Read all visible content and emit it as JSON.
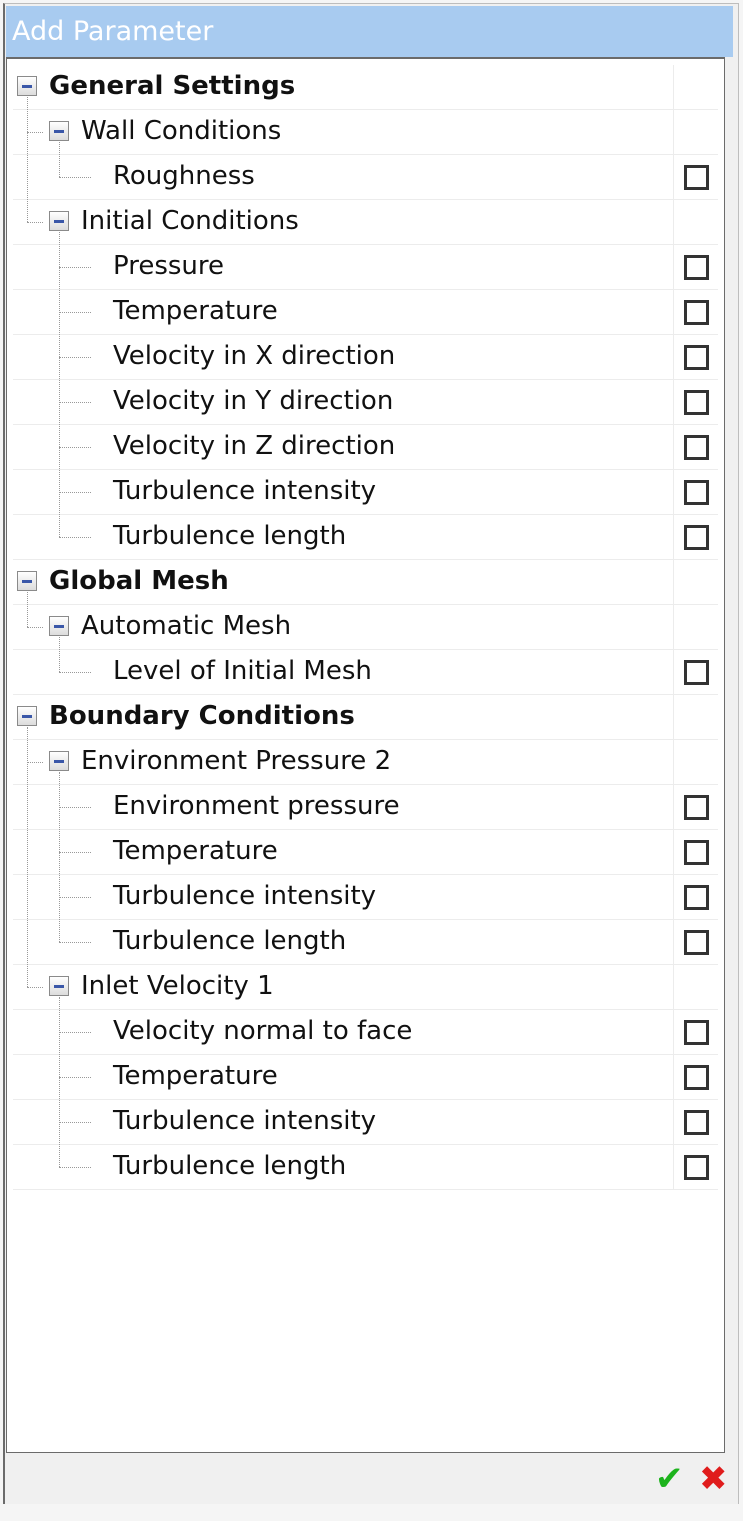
{
  "window": {
    "title": "Add Parameter"
  },
  "tree": [
    {
      "label": "General Settings",
      "level": 0,
      "expanded": true,
      "checkbox": false
    },
    {
      "label": "Wall Conditions",
      "level": 1,
      "expanded": true,
      "checkbox": false
    },
    {
      "label": "Roughness",
      "level": 2,
      "checkbox": true,
      "checked": false
    },
    {
      "label": "Initial Conditions",
      "level": 1,
      "expanded": true,
      "checkbox": false
    },
    {
      "label": "Pressure",
      "level": 2,
      "checkbox": true,
      "checked": false
    },
    {
      "label": "Temperature",
      "level": 2,
      "checkbox": true,
      "checked": false
    },
    {
      "label": "Velocity in X direction",
      "level": 2,
      "checkbox": true,
      "checked": false
    },
    {
      "label": "Velocity in Y direction",
      "level": 2,
      "checkbox": true,
      "checked": false
    },
    {
      "label": "Velocity in Z direction",
      "level": 2,
      "checkbox": true,
      "checked": false
    },
    {
      "label": "Turbulence intensity",
      "level": 2,
      "checkbox": true,
      "checked": false
    },
    {
      "label": "Turbulence length",
      "level": 2,
      "checkbox": true,
      "checked": false
    },
    {
      "label": "Global Mesh",
      "level": 0,
      "expanded": true,
      "checkbox": false
    },
    {
      "label": "Automatic Mesh",
      "level": 1,
      "expanded": true,
      "checkbox": false
    },
    {
      "label": "Level of Initial Mesh",
      "level": 2,
      "checkbox": true,
      "checked": false
    },
    {
      "label": "Boundary Conditions",
      "level": 0,
      "expanded": true,
      "checkbox": false
    },
    {
      "label": "Environment Pressure 2",
      "level": 1,
      "expanded": true,
      "checkbox": false
    },
    {
      "label": "Environment pressure",
      "level": 2,
      "checkbox": true,
      "checked": false
    },
    {
      "label": "Temperature",
      "level": 2,
      "checkbox": true,
      "checked": false
    },
    {
      "label": "Turbulence intensity",
      "level": 2,
      "checkbox": true,
      "checked": false
    },
    {
      "label": "Turbulence length",
      "level": 2,
      "checkbox": true,
      "checked": false
    },
    {
      "label": "Inlet Velocity 1",
      "level": 1,
      "expanded": true,
      "checkbox": false
    },
    {
      "label": "Velocity normal to face",
      "level": 2,
      "checkbox": true,
      "checked": false
    },
    {
      "label": "Temperature",
      "level": 2,
      "checkbox": true,
      "checked": false
    },
    {
      "label": "Turbulence intensity",
      "level": 2,
      "checkbox": true,
      "checked": false
    },
    {
      "label": "Turbulence length",
      "level": 2,
      "checkbox": true,
      "checked": false
    }
  ],
  "footer": {
    "ok_icon": "✔",
    "cancel_icon": "✖"
  },
  "colors": {
    "title_bar": "#a8cbf0",
    "ok": "#1db31d",
    "cancel": "#e01c1c",
    "expander": "#3a57a8"
  }
}
